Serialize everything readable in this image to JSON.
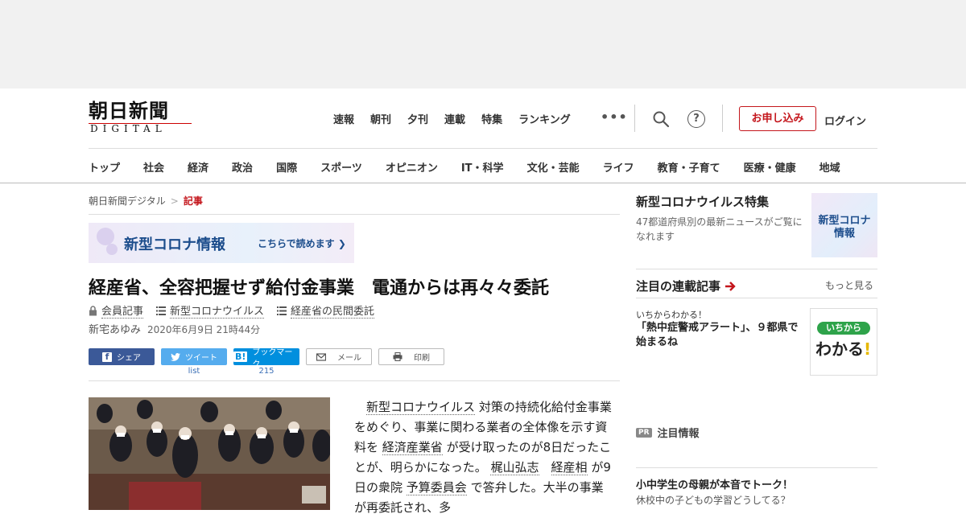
{
  "header": {
    "logo_main": "朝日新聞",
    "logo_sub": "DIGITAL",
    "top_nav": [
      "速報",
      "朝刊",
      "夕刊",
      "連載",
      "特集",
      "ランキング"
    ],
    "more_label": "•••",
    "help_label": "?",
    "subscribe_label": "お申し込み",
    "login_label": "ログイン",
    "categories": [
      "トップ",
      "社会",
      "経済",
      "政治",
      "国際",
      "スポーツ",
      "オピニオン",
      "IT・科学",
      "文化・芸能",
      "ライフ",
      "教育・子育て",
      "医療・健康",
      "地域"
    ]
  },
  "breadcrumb": {
    "home": "朝日新聞デジタル",
    "separator": ">",
    "current": "記事"
  },
  "covid_banner": {
    "title": "新型コロナ情報",
    "link": "こちらで読めます"
  },
  "article": {
    "title": "経産省、全容把握せず給付金事業　電通からは再々々委託",
    "tags": [
      "会員記事",
      "新型コロナウイルス",
      "経産省の民間委託"
    ],
    "author": "新宅あゆみ",
    "date": "2020年6月9日 21時44分",
    "share": {
      "facebook": "シェア",
      "twitter": "ツイート",
      "twitter_count": "list",
      "hatena": "ブックマーク",
      "hatena_count": "215",
      "mail": "メール",
      "print": "印刷"
    },
    "body": {
      "indent": "　",
      "link1": "新型コロナウイルス",
      "text1": "対策の持続化給付金事業をめぐり、事業に関わる業者の全体像を示す資料を",
      "link2": "経済産業省",
      "text2": "が受け取ったのが8日だったことが、明らかになった。",
      "link3": "梶山弘志",
      "link4": "経産相",
      "text3": "が9日の衆院",
      "link5": "予算委員会",
      "text4": "で答弁した。大半の事業が再委託され、多"
    }
  },
  "sidebar": {
    "covid_title": "新型コロナウイルス特集",
    "covid_desc": "47都道府県別の最新ニュースがご覧になれます",
    "covid_thumb_line1": "新型コロナ",
    "covid_thumb_line2": "情報",
    "series_heading": "注目の連載記事",
    "series_more": "もっと見る",
    "series_kicker": "いちからわかる！",
    "series_title": "「熱中症警戒アラート」、９都県で始まるね",
    "series_thumb_top": "いちから",
    "series_thumb_main": "わかる",
    "series_thumb_mark": "!",
    "pr_badge": "PR",
    "pr_heading": "注目情報",
    "ad_title": "小中学生の母親が本音でトーク！",
    "ad_desc": "休校中の子どもの学習どうしてる？"
  }
}
